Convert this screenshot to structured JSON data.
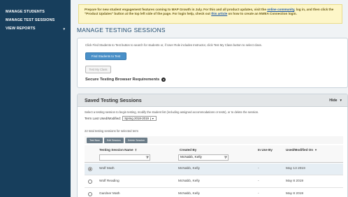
{
  "sidebar": {
    "items": [
      {
        "label": "MANAGE STUDENTS"
      },
      {
        "label": "MANAGE TEST SESSIONS"
      },
      {
        "label": "VIEW REPORTS",
        "arrow": "▼"
      }
    ]
  },
  "notice": {
    "text1": "Prepare for new student engagement features coming to MAP Growth in July. For this and all product updates, visit the ",
    "link1": "online community",
    "text2": ", log in, and then click the \"Product Updates\" button at the top left side of the page. For login help, check out ",
    "link2": "this article",
    "text3": " on how to create an NWEA Connection login."
  },
  "page_title": "MANAGE TESTING SESSIONS",
  "top_panel": {
    "instructions": "Click Find Students to Test button to search for students or, if User Role includes Instructor, click Test My Class button to select class.",
    "find_button": "Find Students to Test",
    "test_class_button": "Test My Class",
    "secure_label": "Secure Testing Browser Requirements",
    "help_icon": "?"
  },
  "saved_sessions": {
    "title": "Saved Testing Sessions",
    "hide_label": "Hide",
    "hide_arrow": "▼",
    "instructions": "Select a testing session to begin testing, modify the student list (including assigned accommodations or tests), or to delete the session.",
    "term_label": "Term Last Used/Modified:",
    "term_value": "Spring 2018-2019",
    "total_text": "22 total testing sessions for selected term",
    "actions": [
      {
        "label": "Test Now"
      },
      {
        "label": "Edit Session"
      },
      {
        "label": "Delete Session"
      }
    ],
    "columns": {
      "name": "Testing Session Name",
      "name_sort": "⇧",
      "created_by": "Created By",
      "in_use_by": "In Use By",
      "used_modified": "Used/Modified On",
      "used_modified_sort": "▼"
    },
    "filters": {
      "name": "",
      "created_by": "McNabb, Kelly"
    },
    "rows": [
      {
        "name": "Wolf Math",
        "created_by": "McNabb, Kelly",
        "in_use_by": "-",
        "date": "May 13 2019",
        "selected": true
      },
      {
        "name": "Wolf Reading",
        "created_by": "McNabb, Kelly",
        "in_use_by": "-",
        "date": "May 8 2019",
        "selected": false
      },
      {
        "name": "Gardner Math",
        "created_by": "McNabb, Kelly",
        "in_use_by": "-",
        "date": "May 8 2019",
        "selected": false
      }
    ]
  },
  "colors": {
    "sidebar_bg": "#173e5c",
    "primary_button": "#4a90c8",
    "notice_bg": "#fdf6c8",
    "title_color": "#1e4a6e"
  }
}
